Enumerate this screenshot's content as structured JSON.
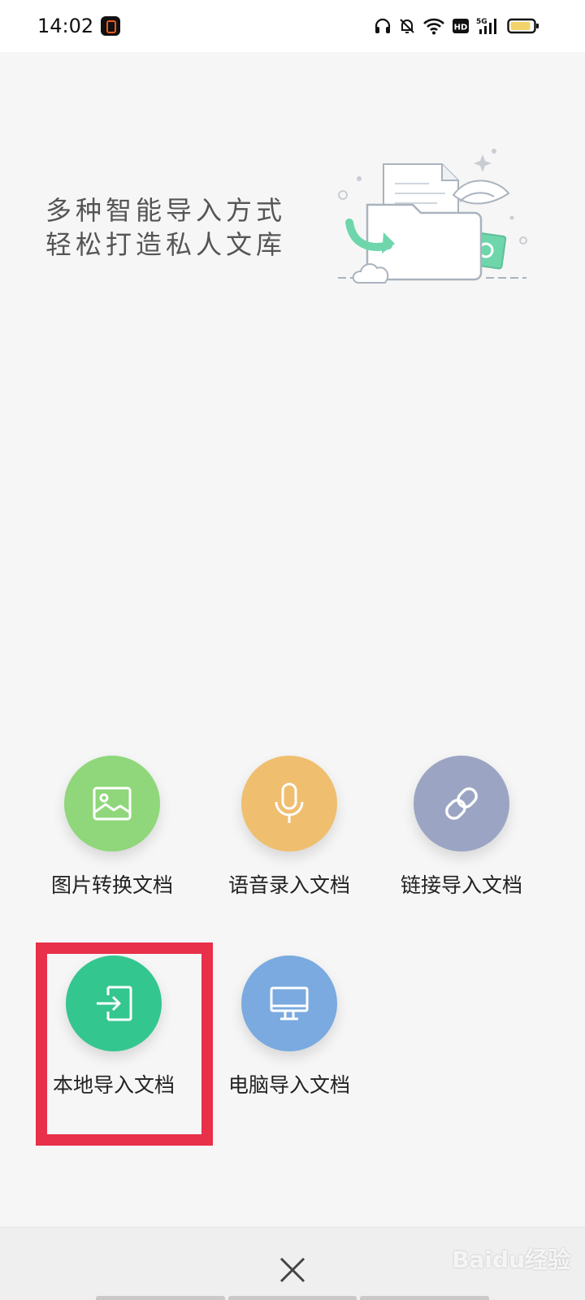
{
  "status_bar": {
    "time": "14:02",
    "icons": [
      "headset-icon",
      "bell-muted-icon",
      "wifi-icon",
      "hd-icon",
      "5g-signal-icon",
      "battery-icon"
    ],
    "hd_label": "HD",
    "network_label": "5G"
  },
  "banner": {
    "line1": "多种智能导入方式",
    "line2": "轻松打造私人文库",
    "illustration": "folder-import-illustration"
  },
  "options": [
    {
      "label": "图片转换文档",
      "icon": "image-icon",
      "color": "#8fd77a"
    },
    {
      "label": "语音录入文档",
      "icon": "microphone-icon",
      "color": "#efbf6f"
    },
    {
      "label": "链接导入文档",
      "icon": "link-icon",
      "color": "#9ba5c3"
    },
    {
      "label": "本地导入文档",
      "icon": "import-icon",
      "color": "#34c68f"
    },
    {
      "label": "电脑导入文档",
      "icon": "monitor-icon",
      "color": "#7aaadf"
    }
  ],
  "highlight_color": "#e8304a",
  "bottom_bar": {
    "close_icon": "close-icon"
  },
  "watermark": {
    "text": "Baidu经验"
  }
}
